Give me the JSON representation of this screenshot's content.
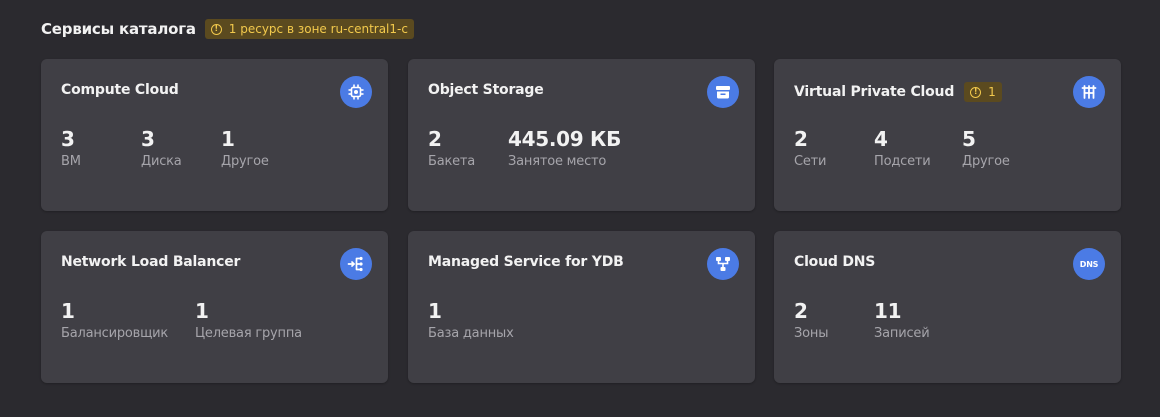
{
  "header": {
    "title": "Сервисы каталога",
    "warning": "1 ресурс в зоне ru-central1-c"
  },
  "colors": {
    "background": "#2b2a2f",
    "card": "#403f45",
    "accent": "#4b7be5",
    "warning_text": "#f2c94c",
    "warning_bg": "#5b4a1f"
  },
  "cards": [
    {
      "title": "Compute Cloud",
      "icon": "cpu-chip-icon",
      "stats": [
        {
          "value": "3",
          "label": "ВМ"
        },
        {
          "value": "3",
          "label": "Диска"
        },
        {
          "value": "1",
          "label": "Другое"
        }
      ]
    },
    {
      "title": "Object Storage",
      "icon": "bucket-storage-icon",
      "stats": [
        {
          "value": "2",
          "label": "Бакета"
        },
        {
          "value": "445.09 КБ",
          "label": "Занятое место"
        }
      ]
    },
    {
      "title": "Virtual Private Cloud",
      "icon": "network-icon",
      "warning": "1",
      "stats": [
        {
          "value": "2",
          "label": "Сети"
        },
        {
          "value": "4",
          "label": "Подсети"
        },
        {
          "value": "5",
          "label": "Другое"
        }
      ]
    },
    {
      "title": "Network Load Balancer",
      "icon": "load-balancer-icon",
      "stats": [
        {
          "value": "1",
          "label": "Балансировщик"
        },
        {
          "value": "1",
          "label": "Целевая группа"
        }
      ]
    },
    {
      "title": "Managed Service for YDB",
      "icon": "database-tree-icon",
      "stats": [
        {
          "value": "1",
          "label": "База данных"
        }
      ]
    },
    {
      "title": "Cloud DNS",
      "icon": "dns-icon",
      "icon_text": "DNS",
      "stats": [
        {
          "value": "2",
          "label": "Зоны"
        },
        {
          "value": "11",
          "label": "Записей"
        }
      ]
    }
  ]
}
